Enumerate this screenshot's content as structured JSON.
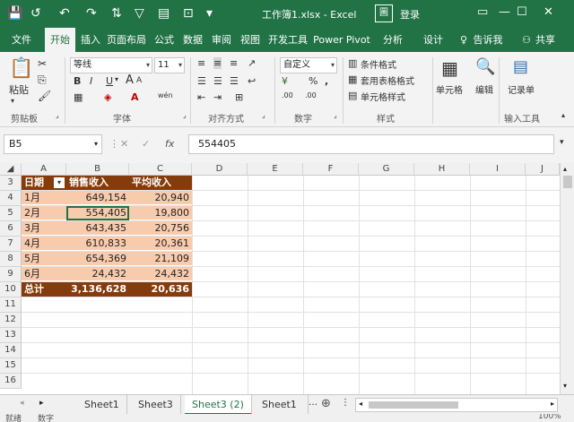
{
  "window": {
    "title": "工作簿1.xlsx - Excel",
    "login": "登录",
    "ribbon_options_icon": "圖"
  },
  "tabs": [
    "文件",
    "开始",
    "插入",
    "页面布局",
    "公式",
    "数据",
    "审阅",
    "视图",
    "开发工具",
    "Power Pivot",
    "分析",
    "设计"
  ],
  "tell_me": "告诉我",
  "share": "共享",
  "ribbon": {
    "clipboard": {
      "paste": "粘贴",
      "label": "剪贴板"
    },
    "font": {
      "name": "等线",
      "size": "11",
      "label": "字体",
      "bold": "B",
      "italic": "I",
      "underline": "U",
      "grow": "A",
      "shrink": "A",
      "phonetic": "wén"
    },
    "alignment": {
      "label": "对齐方式"
    },
    "number": {
      "format": "自定义",
      "label": "数字",
      "currency": "¥",
      "percent": "%",
      "comma": ",",
      "inc_decimal": ".00",
      "dec_decimal": ".00"
    },
    "styles": {
      "conditional": "条件格式",
      "table": "套用表格格式",
      "cell": "单元格样式",
      "label": "样式"
    },
    "cells": {
      "label": "单元格"
    },
    "editing": {
      "label": "编辑"
    },
    "record": {
      "label": "记录单"
    },
    "input_tools": {
      "label": "输入工具"
    }
  },
  "formula_bar": {
    "name_box": "B5",
    "value": "554405",
    "fx": "fx"
  },
  "columns": [
    "A",
    "B",
    "C",
    "D",
    "E",
    "F",
    "G",
    "H",
    "I",
    "J"
  ],
  "rows": [
    "3",
    "4",
    "5",
    "6",
    "7",
    "8",
    "9",
    "10",
    "11",
    "12",
    "13",
    "14",
    "15",
    "16"
  ],
  "table": {
    "headers": [
      "日期",
      "销售收入",
      "平均收入"
    ],
    "rows": [
      [
        "1月",
        "649,154",
        "20,940"
      ],
      [
        "2月",
        "554,405",
        "19,800"
      ],
      [
        "3月",
        "643,435",
        "20,756"
      ],
      [
        "4月",
        "610,833",
        "20,361"
      ],
      [
        "5月",
        "654,369",
        "21,109"
      ],
      [
        "6月",
        "24,432",
        "24,432"
      ]
    ],
    "total": [
      "总计",
      "3,136,628",
      "20,636"
    ]
  },
  "sheet_tabs": [
    "Sheet1",
    "Sheet3",
    "Sheet3 (2)",
    "Sheet1"
  ],
  "status": {
    "left": "就绪",
    "mode": "数字",
    "zoom": "100%"
  }
}
